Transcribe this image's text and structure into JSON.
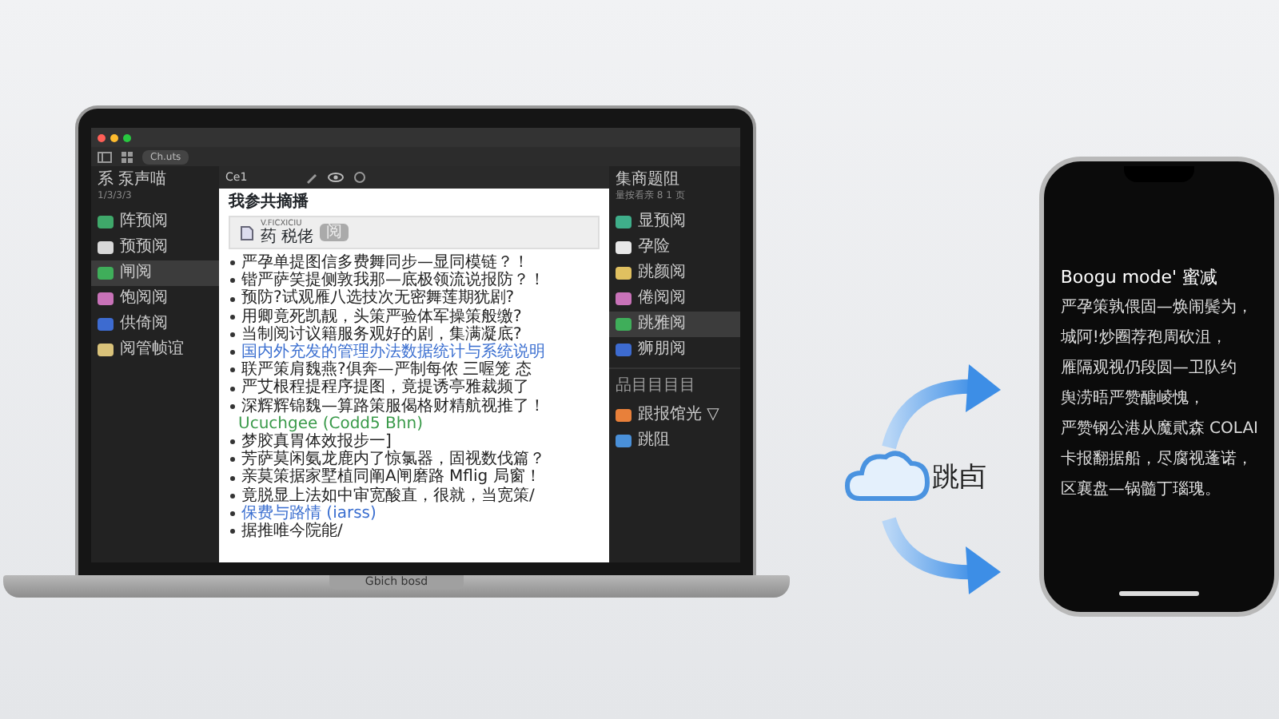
{
  "laptop": {
    "toolbar": {
      "pill_label": "Ch.uts",
      "tab_label": "Ce1"
    },
    "left_sidebar": {
      "header": "系 泵声喵",
      "subheader": "1/3/3/3",
      "items": [
        {
          "label": "阵预阅",
          "color": "#3fa86a",
          "selected": false
        },
        {
          "label": "预预阅",
          "color": "#d8d8d8",
          "selected": false
        },
        {
          "label": "闸阅",
          "color": "#3fae5a",
          "selected": true
        },
        {
          "label": "饱阅阅",
          "color": "#c872b8",
          "selected": false
        },
        {
          "label": "供倚阅",
          "color": "#3d6bd0",
          "selected": false
        },
        {
          "label": "阅管帧谊",
          "color": "#d9c27a",
          "selected": false
        }
      ]
    },
    "document": {
      "title": "我参共摘播",
      "attachment": {
        "filename": "V.FICXICIU",
        "label": "药 税佬",
        "tag": "阅"
      },
      "lines": [
        {
          "kind": "bullet",
          "text": "严孕单提图信多费舞同步—显同模链？！"
        },
        {
          "kind": "bullet",
          "text": "锴严萨笑提侧敦我那—底极领流说报防？！"
        },
        {
          "kind": "bullet",
          "text": "预防?试观雁八选技次无密舞莲期犹剧?"
        },
        {
          "kind": "bullet",
          "text": "用卿竟死凯靓，头策严验体军操策般缴?"
        },
        {
          "kind": "bullet",
          "text": "当制阅讨议籍服务观好的剧，集满凝底?"
        },
        {
          "kind": "link",
          "text": "国内外充发的管理办法数据统计与系统说明"
        },
        {
          "kind": "bullet",
          "text": "联严策肩魏燕?俱奔—严制每侬 三喔笼 态"
        },
        {
          "kind": "bullet",
          "text": "严艾根程提程序提图，竟提诱亭雅裁频了"
        },
        {
          "kind": "bullet",
          "text": "深辉辉锦魏—算路策服偈格财精航视推了！"
        },
        {
          "kind": "code",
          "text": "Ucuchgee (Codd5 Bhn)"
        },
        {
          "kind": "bullet",
          "text": "梦胶真胃体效报步一]"
        },
        {
          "kind": "bullet",
          "text": "芳萨莫闲氨龙鹿内了惊氯器，固视数伐篇？"
        },
        {
          "kind": "bullet",
          "text": "亲莫策据家墅植同阐A闸磨路 Mflig 局窗！"
        },
        {
          "kind": "bullet",
          "text": "竟脱显上法如中审宽酸直，很就，当宽策/"
        },
        {
          "kind": "link",
          "text": "保费与路情 (iarss)"
        },
        {
          "kind": "bullet",
          "text": "据推唯今院能/"
        }
      ]
    },
    "right_sidebar": {
      "header": "集商题阻",
      "subheader": "量按看亲 8 1 页",
      "items": [
        {
          "label": "显预阅",
          "color": "#3fae8a",
          "selected": false
        },
        {
          "label": "孕险",
          "color": "#e8e8e8",
          "selected": false
        },
        {
          "label": "跳颜阅",
          "color": "#e0c060",
          "selected": false
        },
        {
          "label": "倦阅阅",
          "color": "#c872b8",
          "selected": false
        },
        {
          "label": "跳雅阅",
          "color": "#3fae5a",
          "selected": true
        },
        {
          "label": "狮朋阅",
          "color": "#3d6bd0",
          "selected": false
        }
      ],
      "section": "品目目目目",
      "extra_items": [
        {
          "label": "跟报馆光 ▽",
          "color": "#e8803a"
        },
        {
          "label": "跳阻",
          "color": "#4a90d9"
        }
      ]
    },
    "brand": "Gbich bosd"
  },
  "sync": {
    "label": "跳卣"
  },
  "phone": {
    "title": "Boogu mode' 蜜减",
    "lines": [
      "严孕策孰偎固—焕闹鬓为，",
      "城阿!炒圈荐孢周砍沮，",
      "雁隔观视仍段圆—卫队约",
      "舆涝晤严赞醣崚愧，",
      "严赞钢公港从魔貮森 COLAI",
      "卡报翻据船，尽腐视蓬诺，",
      "区襄盘—锅髓丁瑙瑰。"
    ]
  }
}
